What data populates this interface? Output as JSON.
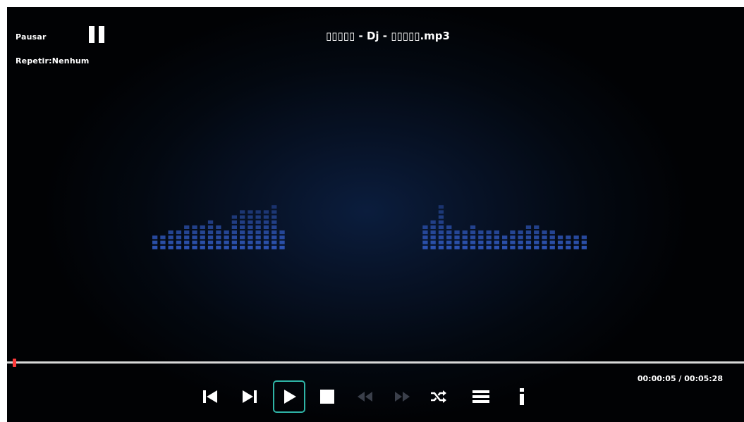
{
  "status": {
    "pause_label": "Pausar",
    "repeat_label": "Repetir:Nenhum"
  },
  "track": {
    "title": "▯▯▯▯▯ - Dj - ▯▯▯▯▯.mp3"
  },
  "playback": {
    "elapsed": "00:00:05",
    "total": "00:05:28",
    "time_text": "00:00:05 / 00:05:28",
    "progress_fraction": 0.015
  },
  "equalizer": {
    "color": "#2f56b8",
    "levels": [
      3,
      3,
      4,
      4,
      5,
      5,
      5,
      6,
      5,
      4,
      7,
      8,
      8,
      8,
      8,
      9,
      4,
      0,
      0,
      0,
      0,
      0,
      0,
      0,
      0,
      0,
      0,
      0,
      0,
      0,
      0,
      0,
      0,
      0,
      5,
      6,
      9,
      5,
      4,
      4,
      5,
      4,
      4,
      4,
      3,
      4,
      4,
      5,
      5,
      4,
      4,
      3,
      3,
      3,
      3
    ]
  },
  "controls": {
    "icons": [
      "skip-previous-icon",
      "skip-next-icon",
      "play-icon",
      "stop-icon",
      "rewind-icon",
      "fast-forward-icon",
      "shuffle-icon",
      "playlist-icon",
      "info-icon"
    ],
    "focused": "play-icon",
    "accent_color": "#2fb4a6",
    "disabled_color": "#3a3f4a"
  },
  "colors": {
    "seek_handle": "#ff3b3b",
    "seek_track": "#d8d8d8"
  }
}
